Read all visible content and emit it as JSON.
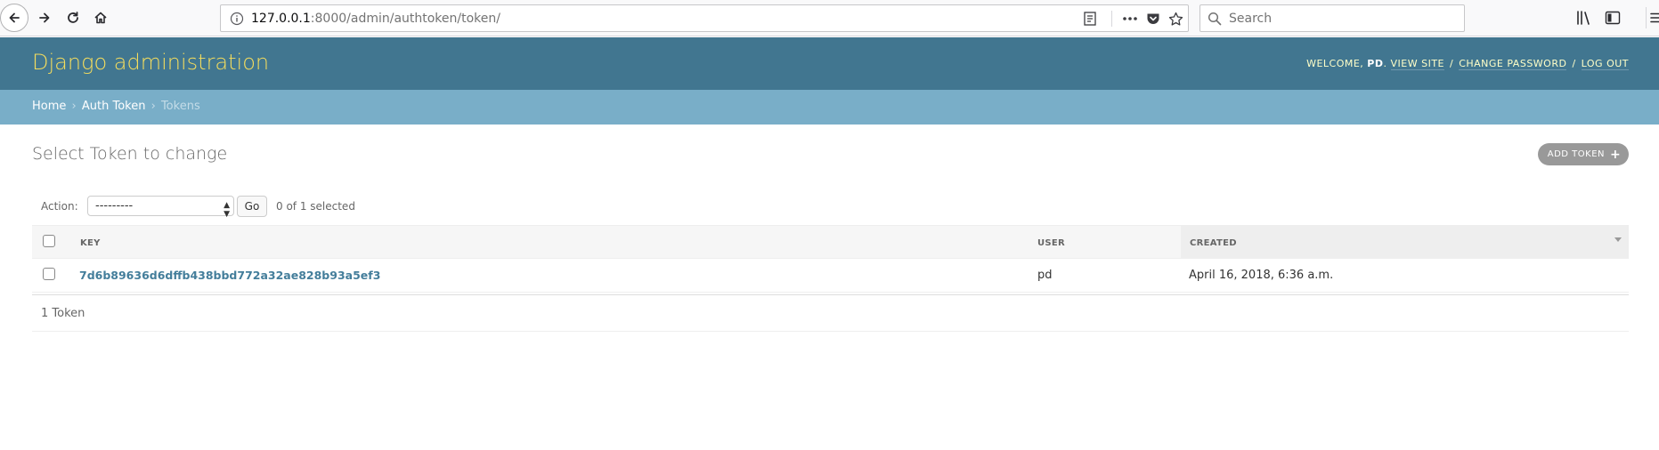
{
  "browser": {
    "url_host": "127.0.0.1",
    "url_path": ":8000/admin/authtoken/token/",
    "search_placeholder": "Search"
  },
  "header": {
    "branding": "Django administration",
    "welcome": "Welcome,",
    "username": "PD",
    "view_site": "View site",
    "change_password": "Change password",
    "log_out": "Log out"
  },
  "breadcrumbs": {
    "home": "Home",
    "app": "Auth Token",
    "current": "Tokens",
    "separator": "›"
  },
  "content": {
    "title": "Select Token to change",
    "add_button": "Add Token"
  },
  "actions": {
    "label": "Action:",
    "selected_value": "---------",
    "go_label": "Go",
    "selected_count": "0 of 1 selected"
  },
  "table": {
    "headers": {
      "key": "Key",
      "user": "User",
      "created": "Created"
    },
    "rows": [
      {
        "key": "7d6b89636d6dffb438bbd772a32ae828b93a5ef3",
        "user": "pd",
        "created": "April 16, 2018, 6:36 a.m."
      }
    ]
  },
  "paginator": {
    "count_text": "1 Token"
  },
  "colors": {
    "header_bg": "#417690",
    "breadcrumb_bg": "#79aec8",
    "branding": "#f5dd5d",
    "link": "#447e9b"
  }
}
